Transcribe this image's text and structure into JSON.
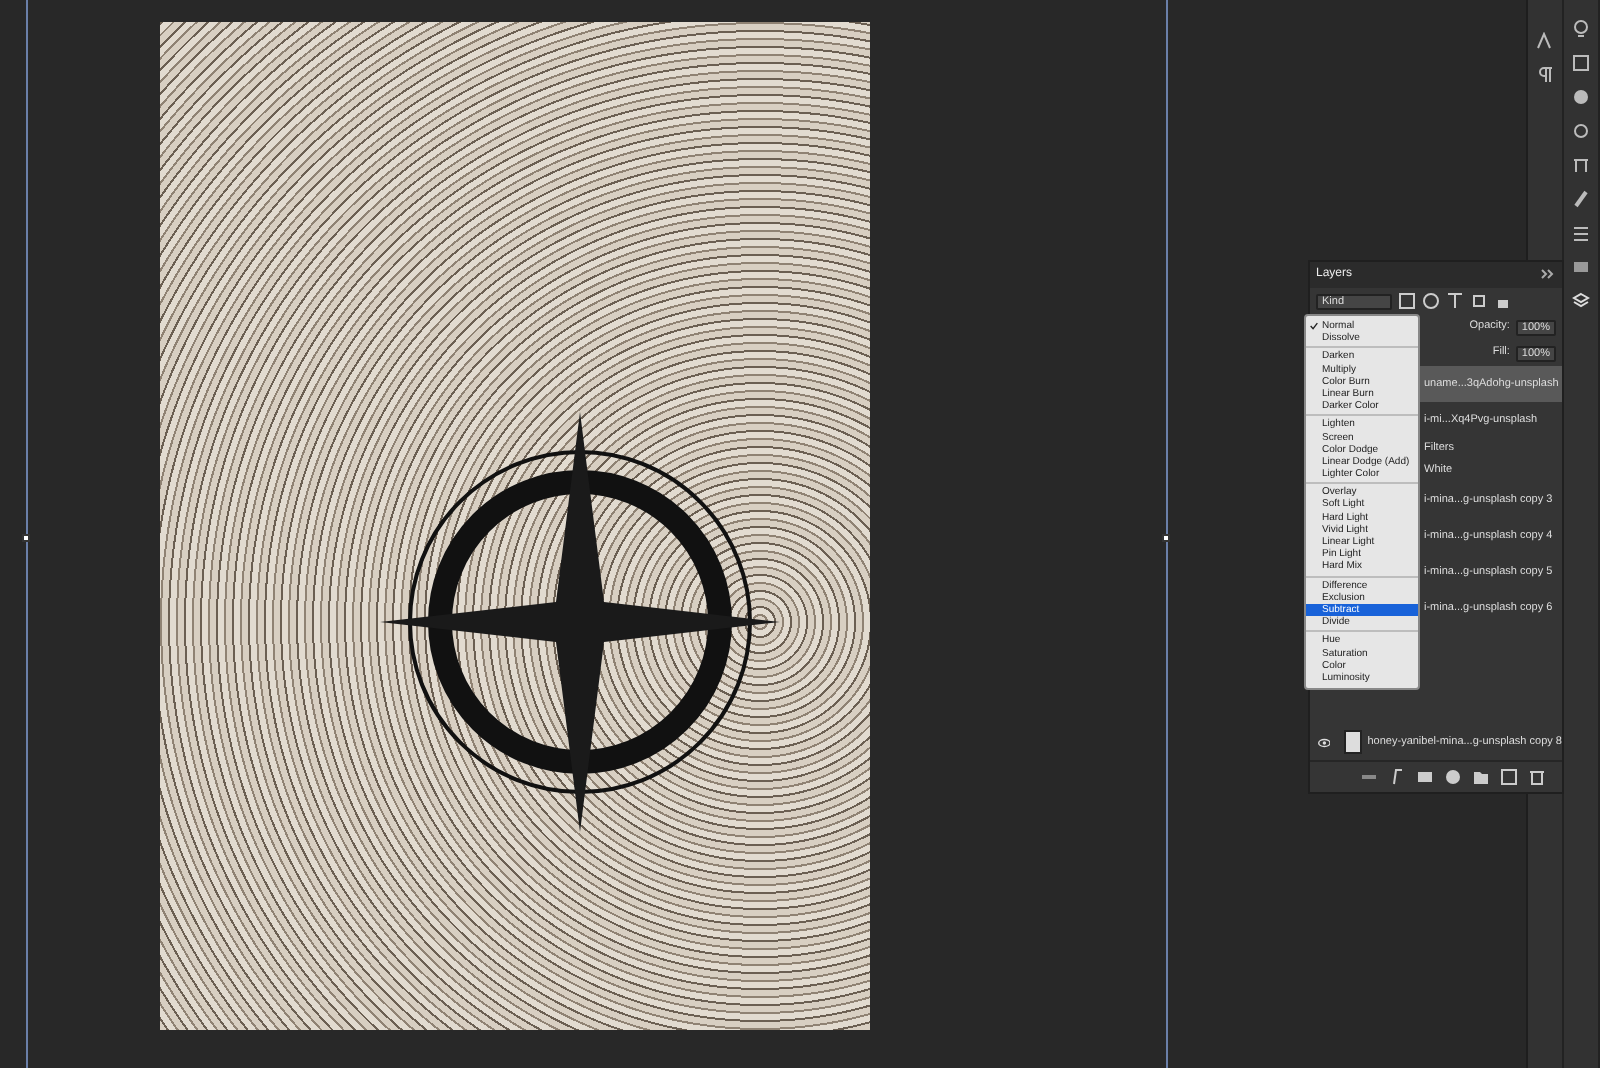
{
  "layers_panel": {
    "title": "Layers",
    "filter": "Kind",
    "opacity_label": "Opacity:",
    "opacity": "100%",
    "fill_label": "Fill:",
    "fill": "100%",
    "layers": [
      {
        "kind": "layer",
        "name": "uname...3qAdohg-unsplash",
        "selected": true
      },
      {
        "kind": "layer",
        "name": "i-mi...Xq4Pvg-unsplash",
        "selected": false
      },
      {
        "kind": "effect",
        "name": "Filters",
        "selected": false
      },
      {
        "kind": "effect",
        "name": "White",
        "selected": false
      },
      {
        "kind": "layer",
        "name": "i-mina...g-unsplash copy 3",
        "selected": false
      },
      {
        "kind": "layer",
        "name": "i-mina...g-unsplash copy 4",
        "selected": false
      },
      {
        "kind": "layer",
        "name": "i-mina...g-unsplash copy 5",
        "selected": false
      },
      {
        "kind": "layer",
        "name": "i-mina...g-unsplash copy 6",
        "selected": false
      },
      {
        "kind": "layer",
        "name": "honey-yanibel-mina...g-unsplash copy 8",
        "selected": false,
        "visible": true
      }
    ]
  },
  "blend_menu": {
    "groups": [
      [
        {
          "label": "Normal",
          "checked": true,
          "selected": false
        },
        {
          "label": "Dissolve",
          "checked": false,
          "selected": false
        }
      ],
      [
        {
          "label": "Darken",
          "checked": false,
          "selected": false
        },
        {
          "label": "Multiply",
          "checked": false,
          "selected": false
        },
        {
          "label": "Color Burn",
          "checked": false,
          "selected": false
        },
        {
          "label": "Linear Burn",
          "checked": false,
          "selected": false
        },
        {
          "label": "Darker Color",
          "checked": false,
          "selected": false
        }
      ],
      [
        {
          "label": "Lighten",
          "checked": false,
          "selected": false
        },
        {
          "label": "Screen",
          "checked": false,
          "selected": false
        },
        {
          "label": "Color Dodge",
          "checked": false,
          "selected": false
        },
        {
          "label": "Linear Dodge (Add)",
          "checked": false,
          "selected": false
        },
        {
          "label": "Lighter Color",
          "checked": false,
          "selected": false
        }
      ],
      [
        {
          "label": "Overlay",
          "checked": false,
          "selected": false
        },
        {
          "label": "Soft Light",
          "checked": false,
          "selected": false
        },
        {
          "label": "Hard Light",
          "checked": false,
          "selected": false
        },
        {
          "label": "Vivid Light",
          "checked": false,
          "selected": false
        },
        {
          "label": "Linear Light",
          "checked": false,
          "selected": false
        },
        {
          "label": "Pin Light",
          "checked": false,
          "selected": false
        },
        {
          "label": "Hard Mix",
          "checked": false,
          "selected": false
        }
      ],
      [
        {
          "label": "Difference",
          "checked": false,
          "selected": false
        },
        {
          "label": "Exclusion",
          "checked": false,
          "selected": false
        },
        {
          "label": "Subtract",
          "checked": false,
          "selected": true
        },
        {
          "label": "Divide",
          "checked": false,
          "selected": false
        }
      ],
      [
        {
          "label": "Hue",
          "checked": false,
          "selected": false
        },
        {
          "label": "Saturation",
          "checked": false,
          "selected": false
        },
        {
          "label": "Color",
          "checked": false,
          "selected": false
        },
        {
          "label": "Luminosity",
          "checked": false,
          "selected": false
        }
      ]
    ]
  }
}
